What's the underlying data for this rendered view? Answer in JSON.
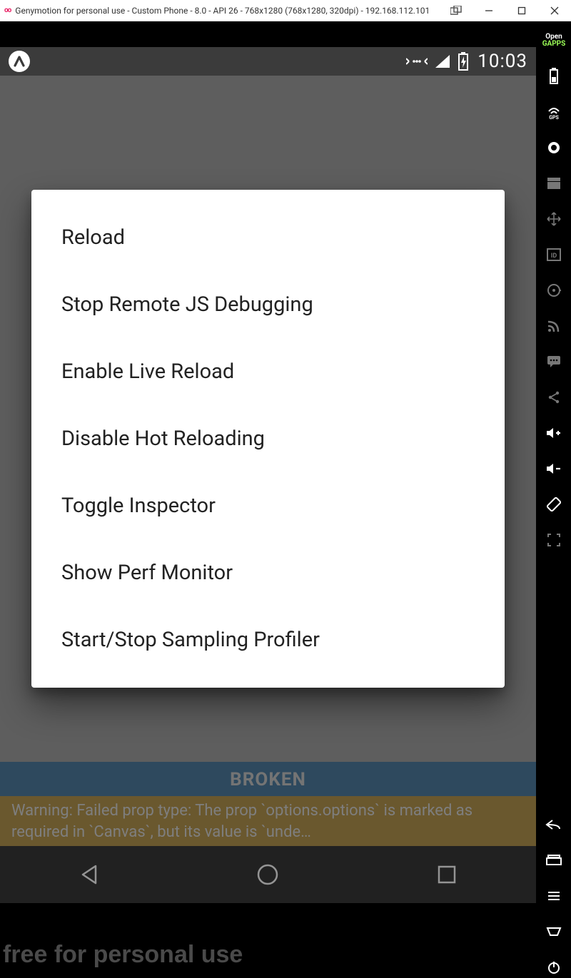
{
  "window": {
    "title": "Genymotion for personal use - Custom Phone - 8.0 - API 26 - 768x1280 (768x1280, 320dpi) - 192.168.112.101"
  },
  "statusbar": {
    "clock": "10:03"
  },
  "dev_menu": {
    "items": [
      "Reload",
      "Stop Remote JS Debugging",
      "Enable Live Reload",
      "Disable Hot Reloading",
      "Toggle Inspector",
      "Show Perf Monitor",
      "Start/Stop Sampling Profiler"
    ]
  },
  "banners": {
    "broken": "BROKEN",
    "warning": "Warning: Failed prop type: The prop `options.options` is marked as required in `Canvas`, but its value is `unde…"
  },
  "footer": "free for personal use",
  "sidebar": {
    "gapps": "Open GAPPS"
  }
}
